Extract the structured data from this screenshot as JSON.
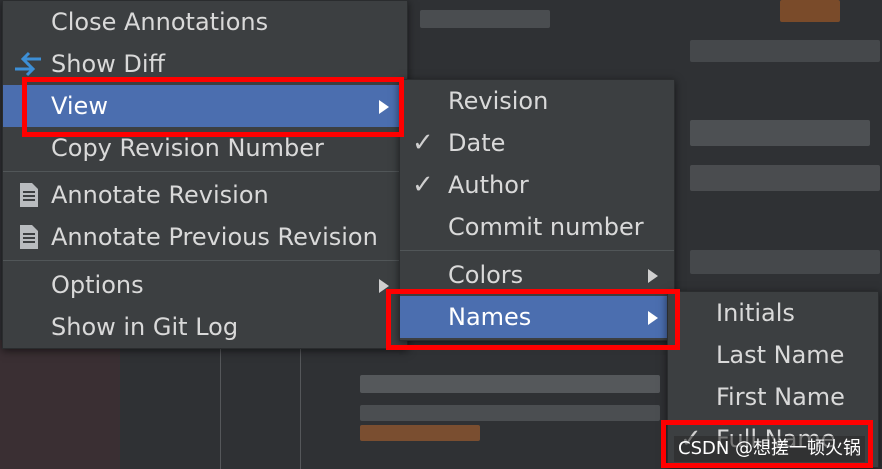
{
  "main_menu": {
    "items": [
      {
        "label": "Close Annotations"
      },
      {
        "label": "Show Diff"
      },
      {
        "label": "View"
      },
      {
        "label": "Copy Revision Number"
      },
      {
        "label": "Annotate Revision"
      },
      {
        "label": "Annotate Previous Revision"
      },
      {
        "label": "Options"
      },
      {
        "label": "Show in Git Log"
      }
    ]
  },
  "view_menu": {
    "items": [
      {
        "label": "Revision",
        "checked": false
      },
      {
        "label": "Date",
        "checked": true
      },
      {
        "label": "Author",
        "checked": true
      },
      {
        "label": "Commit number",
        "checked": false
      },
      {
        "label": "Colors",
        "checked": false
      },
      {
        "label": "Names",
        "checked": false
      }
    ]
  },
  "names_menu": {
    "items": [
      {
        "label": "Initials",
        "checked": false
      },
      {
        "label": "Last Name",
        "checked": false
      },
      {
        "label": "First Name",
        "checked": false
      },
      {
        "label": "Full Name",
        "checked": true
      }
    ]
  },
  "check_glyph": "✓",
  "watermark": "CSDN @想搓一顿火锅",
  "colors": {
    "menu_bg": "#3c3f41",
    "selected_bg": "#4b6eaf",
    "highlight_box": "#ff0000",
    "text": "#d9d9d9"
  }
}
